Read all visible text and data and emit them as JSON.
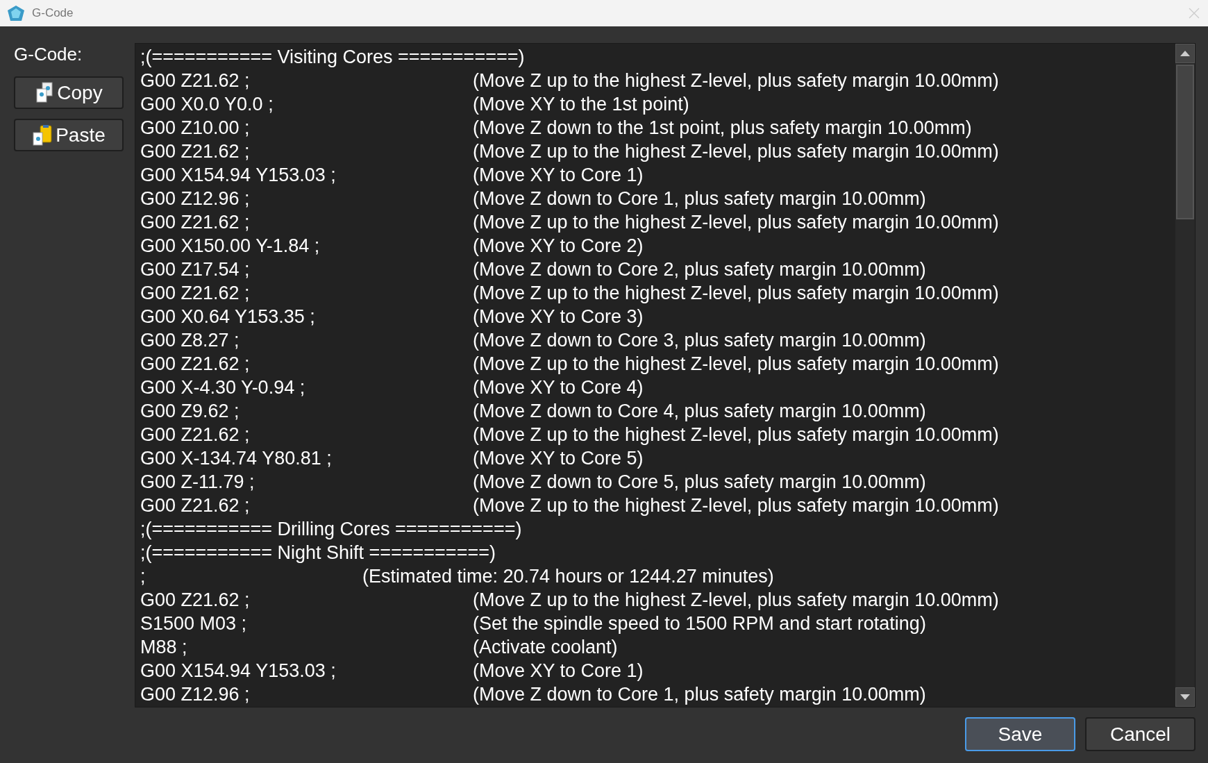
{
  "window": {
    "title": "G-Code"
  },
  "label": "G-Code:",
  "side_buttons": [
    {
      "label": "Copy",
      "kind": "copy"
    },
    {
      "label": "Paste",
      "kind": "paste"
    }
  ],
  "lines": [
    {
      "kind": "header",
      "text": ";(=========== Visiting Cores ===========)"
    },
    {
      "kind": "command",
      "code": "G00 Z21.62 ;",
      "comment": "(Move Z up to the highest Z-level, plus safety margin 10.00mm)"
    },
    {
      "kind": "command",
      "code": "G00 X0.0 Y0.0 ;",
      "comment": "(Move XY to the 1st point)"
    },
    {
      "kind": "command",
      "code": "G00 Z10.00 ;",
      "comment": "(Move Z down to the 1st point, plus safety margin 10.00mm)"
    },
    {
      "kind": "command",
      "code": "G00 Z21.62 ;",
      "comment": "(Move Z up to the highest Z-level, plus safety margin 10.00mm)"
    },
    {
      "kind": "command",
      "code": "G00 X154.94 Y153.03 ;",
      "comment": "(Move XY to Core 1)"
    },
    {
      "kind": "command",
      "code": "G00 Z12.96 ;",
      "comment": "(Move Z down to Core 1, plus safety margin 10.00mm)"
    },
    {
      "kind": "command",
      "code": "G00 Z21.62 ;",
      "comment": "(Move Z up to the highest Z-level, plus safety margin 10.00mm)"
    },
    {
      "kind": "command",
      "code": "G00 X150.00 Y-1.84 ;",
      "comment": "(Move XY to Core 2)"
    },
    {
      "kind": "command",
      "code": "G00 Z17.54 ;",
      "comment": "(Move Z down to Core 2, plus safety margin 10.00mm)"
    },
    {
      "kind": "command",
      "code": "G00 Z21.62 ;",
      "comment": "(Move Z up to the highest Z-level, plus safety margin 10.00mm)"
    },
    {
      "kind": "command",
      "code": "G00 X0.64 Y153.35 ;",
      "comment": "(Move XY to Core 3)"
    },
    {
      "kind": "command",
      "code": "G00 Z8.27 ;",
      "comment": "(Move Z down to Core 3, plus safety margin 10.00mm)"
    },
    {
      "kind": "command",
      "code": "G00 Z21.62 ;",
      "comment": "(Move Z up to the highest Z-level, plus safety margin 10.00mm)"
    },
    {
      "kind": "command",
      "code": "G00 X-4.30 Y-0.94 ;",
      "comment": "(Move XY to Core 4)"
    },
    {
      "kind": "command",
      "code": "G00 Z9.62 ;",
      "comment": "(Move Z down to Core 4, plus safety margin 10.00mm)"
    },
    {
      "kind": "command",
      "code": "G00 Z21.62 ;",
      "comment": "(Move Z up to the highest Z-level, plus safety margin 10.00mm)"
    },
    {
      "kind": "command",
      "code": "G00 X-134.74 Y80.81 ;",
      "comment": "(Move XY to Core 5)"
    },
    {
      "kind": "command",
      "code": "G00 Z-11.79 ;",
      "comment": "(Move Z down to Core 5, plus safety margin 10.00mm)"
    },
    {
      "kind": "command",
      "code": "G00 Z21.62 ;",
      "comment": "(Move Z up to the highest Z-level, plus safety margin 10.00mm)"
    },
    {
      "kind": "header",
      "text": ";(=========== Drilling Cores ===========)"
    },
    {
      "kind": "header",
      "text": ";(=========== Night Shift ===========)"
    },
    {
      "kind": "estimate",
      "code": ";",
      "comment": "(Estimated time: 20.74 hours or 1244.27 minutes)"
    },
    {
      "kind": "command",
      "code": "G00 Z21.62 ;",
      "comment": "(Move Z up to the highest Z-level, plus safety margin 10.00mm)"
    },
    {
      "kind": "command",
      "code": "S1500 M03 ;",
      "comment": "(Set the spindle speed to 1500 RPM and start rotating)"
    },
    {
      "kind": "command",
      "code": "M88 ;",
      "comment": "(Activate coolant)"
    },
    {
      "kind": "command",
      "code": "G00 X154.94 Y153.03 ;",
      "comment": "(Move XY to Core 1)"
    },
    {
      "kind": "command",
      "code": "G00 Z12.96 ;",
      "comment": "(Move Z down to Core 1, plus safety margin 10.00mm)"
    }
  ],
  "footer_buttons": [
    {
      "label": "Save",
      "selected": true
    },
    {
      "label": "Cancel",
      "selected": false
    }
  ]
}
